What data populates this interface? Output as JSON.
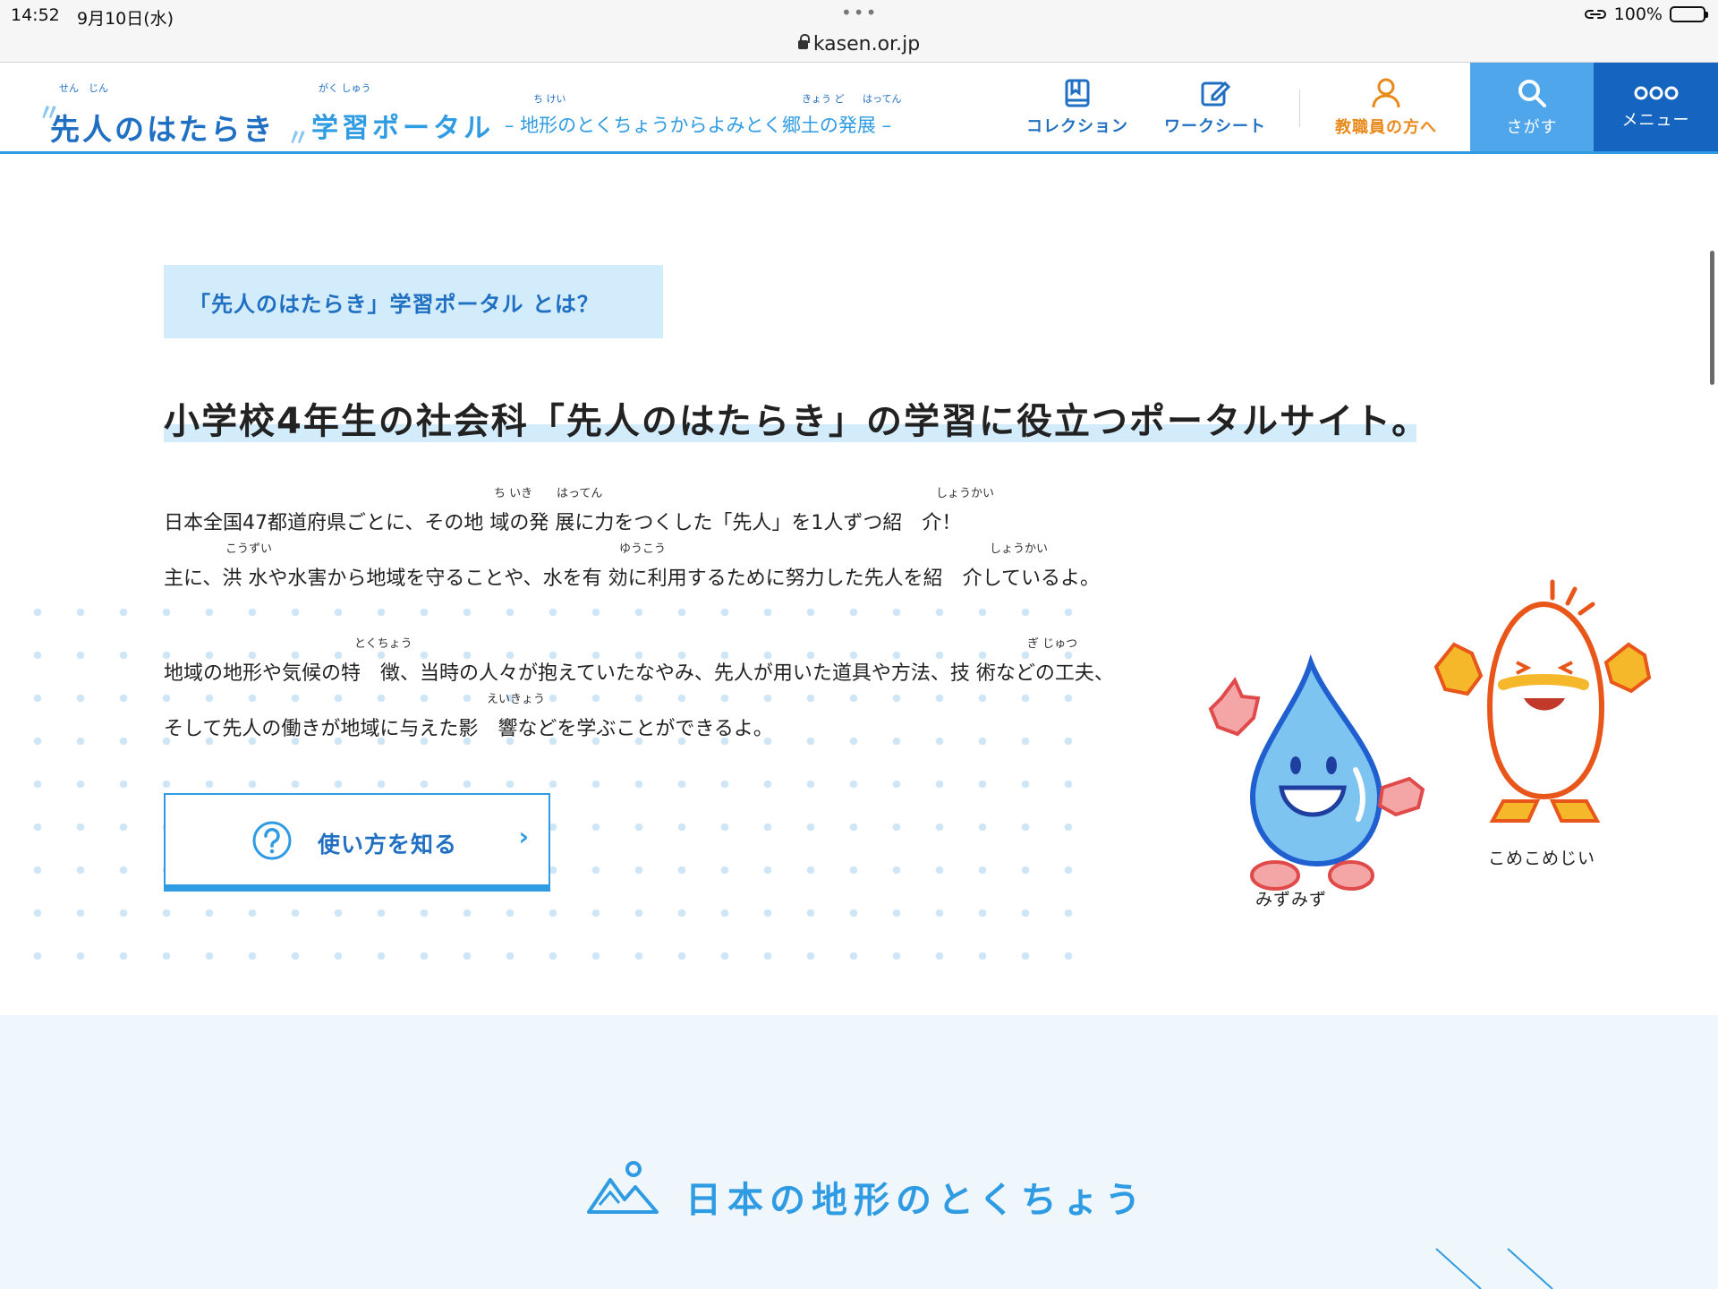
{
  "status": {
    "time": "14:52",
    "date": "9月10日(水)",
    "battery": "100%",
    "battery_level": 1.0,
    "url": "kasen.or.jp"
  },
  "header": {
    "logo_main": "先人のはたらき",
    "logo_main_ruby": "せん　じん",
    "logo_portal": "学習ポータル",
    "logo_portal_ruby": "がく しゅう",
    "logo_sub": "– 地形のとくちょうからよみとく郷土の発展 –",
    "logo_sub_ruby_1": "ち けい",
    "logo_sub_ruby_2": "きょう ど",
    "logo_sub_ruby_3": "はってん",
    "nav": {
      "collection": "コレクション",
      "worksheet": "ワークシート",
      "teachers": "教職員の方へ",
      "search": "さがす",
      "menu": "メニュー"
    },
    "colors": {
      "accent": "#2f9be3",
      "dark": "#1565c0",
      "orange": "#e8891a"
    }
  },
  "intro": {
    "tag": "「先人のはたらき」学習ポータル とは？",
    "headline": "小学校4年生の社会科「先人のはたらき」の学習に役立つポータルサイト。",
    "para1": "日本全国47都道府県ごとに、その地 域の発 展に力をつくした「先人」を1人ずつ紹　介！",
    "para1_ruby_a": "ち いき",
    "para1_ruby_b": "はってん",
    "para1_ruby_c": "しょうかい",
    "para2": "主に、洪 水や水害から地域を守ることや、水を有 効に利用するために努力した先人を紹　介しているよ。",
    "para2_ruby_a": "こうずい",
    "para2_ruby_b": "ゆうこう",
    "para2_ruby_c": "しょうかい",
    "para3": "地域の地形や気候の特　徴、当時の人々が抱えていたなやみ、先人が用いた道具や方法、技 術などの工夫、",
    "para3_ruby_a": "とくちょう",
    "para3_ruby_b": "ぎ じゅつ",
    "para4": "そして先人の働きが地域に与えた影　響などを学ぶことができるよ。",
    "para4_ruby_a": "えいきょう",
    "howto_button": "使い方を知る"
  },
  "characters": {
    "water": "みずみず",
    "rice": "こめこめじい"
  },
  "section2": {
    "title": "日本の地形のとくちょう"
  }
}
